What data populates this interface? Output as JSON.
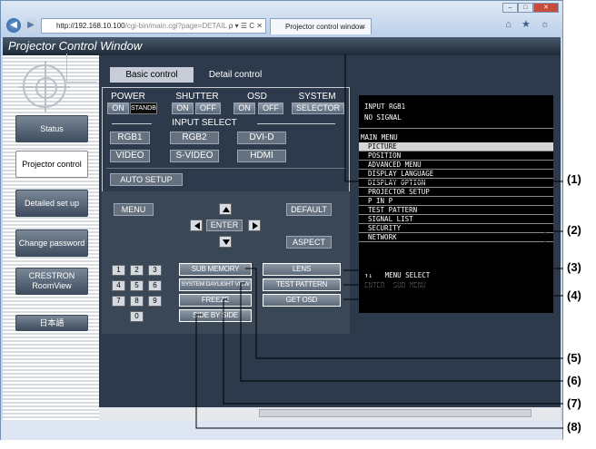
{
  "browser": {
    "address_url_host": "http://192.168.10.100",
    "address_url_path": "/cgi-bin/main.cgi?page=DETAIL",
    "address_controls": "ρ ▾ ☰ C ✕",
    "tab_title": "Projector control window",
    "tab_close": "✕",
    "back": "◀",
    "forward": "▶",
    "window_minimize": "–",
    "window_maximize": "□",
    "window_close": "✕",
    "tools": "⌂ ★ ☼"
  },
  "page_title": "Projector Control Window",
  "sidebar": {
    "items": [
      {
        "label": "Status"
      },
      {
        "label": "Projector control"
      },
      {
        "label": "Detailed set up"
      },
      {
        "label": "Change password"
      },
      {
        "label": "CRESTRON RoomView"
      },
      {
        "label": "日本語"
      }
    ]
  },
  "tabs": {
    "basic": "Basic control",
    "detail": "Detail control"
  },
  "controls": {
    "power": {
      "label": "POWER",
      "on": "ON",
      "standby": "STANDBY"
    },
    "shutter": {
      "label": "SHUTTER",
      "on": "ON",
      "off": "OFF"
    },
    "osd": {
      "label": "OSD",
      "on": "ON",
      "off": "OFF"
    },
    "system": {
      "label": "SYSTEM",
      "selector": "SELECTOR"
    },
    "input_select": {
      "label": "INPUT SELECT",
      "rgb1": "RGB1",
      "rgb2": "RGB2",
      "dvid": "DVI-D",
      "video": "VIDEO",
      "svideo": "S-VIDEO",
      "hdmi": "HDMI"
    },
    "auto_setup": "AUTO SETUP",
    "menu": "MENU",
    "default": "DEFAULT",
    "enter": "ENTER",
    "aspect": "ASPECT",
    "numpad": [
      "1",
      "2",
      "3",
      "4",
      "5",
      "6",
      "7",
      "8",
      "9",
      "0"
    ],
    "sub_memory": "SUB MEMORY",
    "system_daylight_view": "SYSTEM DAYLIGHT VIEW",
    "freeze": "FREEZE",
    "side_by_side": "SIDE BY SIDE",
    "lens": "LENS",
    "test_pattern": "TEST PATTERN",
    "get_osd": "GET OSD"
  },
  "osd_screen": {
    "line1": "INPUT RGB1",
    "line2": "NO SIGNAL",
    "menu_title": "MAIN MENU",
    "menu_items": [
      "PICTURE",
      "POSITION",
      "ADVANCED MENU",
      "DISPLAY LANGUAGE",
      "DISPLAY OPTION",
      "PROJECTOR SETUP",
      "P IN P",
      "TEST PATTERN",
      "SIGNAL LIST",
      "SECURITY",
      "NETWORK"
    ],
    "footer": "↑↓   MENU SELECT",
    "footer2": "ENTER  SUB MENU"
  },
  "callouts": [
    "(1)",
    "(2)",
    "(3)",
    "(4)",
    "(5)",
    "(6)",
    "(7)",
    "(8)"
  ]
}
